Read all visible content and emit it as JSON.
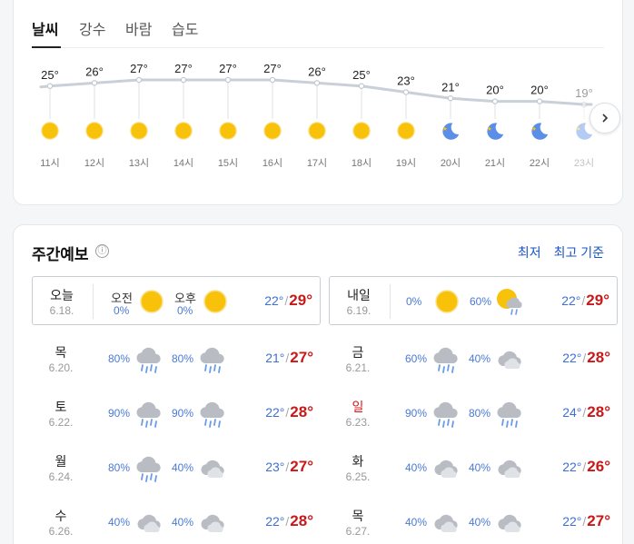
{
  "tabs": [
    "날씨",
    "강수",
    "바람",
    "습도"
  ],
  "hourly": [
    {
      "time": "11시",
      "temp": 25,
      "temp_label": "25°",
      "icon": "sun-icon"
    },
    {
      "time": "12시",
      "temp": 26,
      "temp_label": "26°",
      "icon": "sun-icon"
    },
    {
      "time": "13시",
      "temp": 27,
      "temp_label": "27°",
      "icon": "sun-icon"
    },
    {
      "time": "14시",
      "temp": 27,
      "temp_label": "27°",
      "icon": "sun-icon"
    },
    {
      "time": "15시",
      "temp": 27,
      "temp_label": "27°",
      "icon": "sun-icon"
    },
    {
      "time": "16시",
      "temp": 27,
      "temp_label": "27°",
      "icon": "sun-icon"
    },
    {
      "time": "17시",
      "temp": 26,
      "temp_label": "26°",
      "icon": "sun-icon"
    },
    {
      "time": "18시",
      "temp": 25,
      "temp_label": "25°",
      "icon": "sun-icon"
    },
    {
      "time": "19시",
      "temp": 23,
      "temp_label": "23°",
      "icon": "sun-icon"
    },
    {
      "time": "20시",
      "temp": 21,
      "temp_label": "21°",
      "icon": "moon-icon"
    },
    {
      "time": "21시",
      "temp": 20,
      "temp_label": "20°",
      "icon": "moon-icon"
    },
    {
      "time": "22시",
      "temp": 20,
      "temp_label": "20°",
      "icon": "moon-icon"
    },
    {
      "time": "23시",
      "temp": 19,
      "temp_label": "19°",
      "icon": "moon-icon"
    }
  ],
  "weekly": {
    "title": "주간예보",
    "info_icon": "ⓘ",
    "sort_low": "최저",
    "sort_high": "최고 기준",
    "am_label": "오전",
    "pm_label": "오후",
    "days": [
      {
        "name": "오늘",
        "date": "6.18.",
        "am_pct": "0%",
        "am_icon": "sun-icon",
        "pm_pct": "0%",
        "pm_icon": "sun-icon",
        "low": "22°",
        "high": "29°",
        "sunday": false
      },
      {
        "name": "내일",
        "date": "6.19.",
        "am_pct": "0%",
        "am_icon": "sun-icon",
        "pm_pct": "60%",
        "pm_icon": "sun-rain-icon",
        "low": "22°",
        "high": "29°",
        "sunday": false
      },
      {
        "name": "목",
        "date": "6.20.",
        "am_pct": "80%",
        "am_icon": "rain-icon",
        "pm_pct": "80%",
        "pm_icon": "rain-icon",
        "low": "21°",
        "high": "27°",
        "sunday": false
      },
      {
        "name": "금",
        "date": "6.21.",
        "am_pct": "60%",
        "am_icon": "rain-icon",
        "pm_pct": "40%",
        "pm_icon": "cloud-icon",
        "low": "22°",
        "high": "28°",
        "sunday": false
      },
      {
        "name": "토",
        "date": "6.22.",
        "am_pct": "90%",
        "am_icon": "rain-icon",
        "pm_pct": "90%",
        "pm_icon": "rain-icon",
        "low": "22°",
        "high": "28°",
        "sunday": false
      },
      {
        "name": "일",
        "date": "6.23.",
        "am_pct": "90%",
        "am_icon": "rain-icon",
        "pm_pct": "80%",
        "pm_icon": "rain-icon",
        "low": "24°",
        "high": "28°",
        "sunday": true
      },
      {
        "name": "월",
        "date": "6.24.",
        "am_pct": "80%",
        "am_icon": "rain-icon",
        "pm_pct": "40%",
        "pm_icon": "cloud-icon",
        "low": "23°",
        "high": "27°",
        "sunday": false
      },
      {
        "name": "화",
        "date": "6.25.",
        "am_pct": "40%",
        "am_icon": "cloud-icon",
        "pm_pct": "40%",
        "pm_icon": "cloud-icon",
        "low": "22°",
        "high": "26°",
        "sunday": false
      },
      {
        "name": "수",
        "date": "6.26.",
        "am_pct": "40%",
        "am_icon": "cloud-icon",
        "pm_pct": "40%",
        "pm_icon": "cloud-icon",
        "low": "22°",
        "high": "28°",
        "sunday": false
      },
      {
        "name": "목",
        "date": "6.27.",
        "am_pct": "40%",
        "am_icon": "cloud-icon",
        "pm_pct": "40%",
        "pm_icon": "cloud-icon",
        "low": "22°",
        "high": "27°",
        "sunday": false
      }
    ]
  },
  "colors": {
    "sun": "#f8c10a",
    "moon": "#5b8ee6",
    "cloud": "#b9bdc3",
    "rain": "#6a9be8",
    "low_temp": "#3d6fd6",
    "high_temp": "#c91818",
    "link": "#1a56c4",
    "curve": "#c9d0d8"
  }
}
